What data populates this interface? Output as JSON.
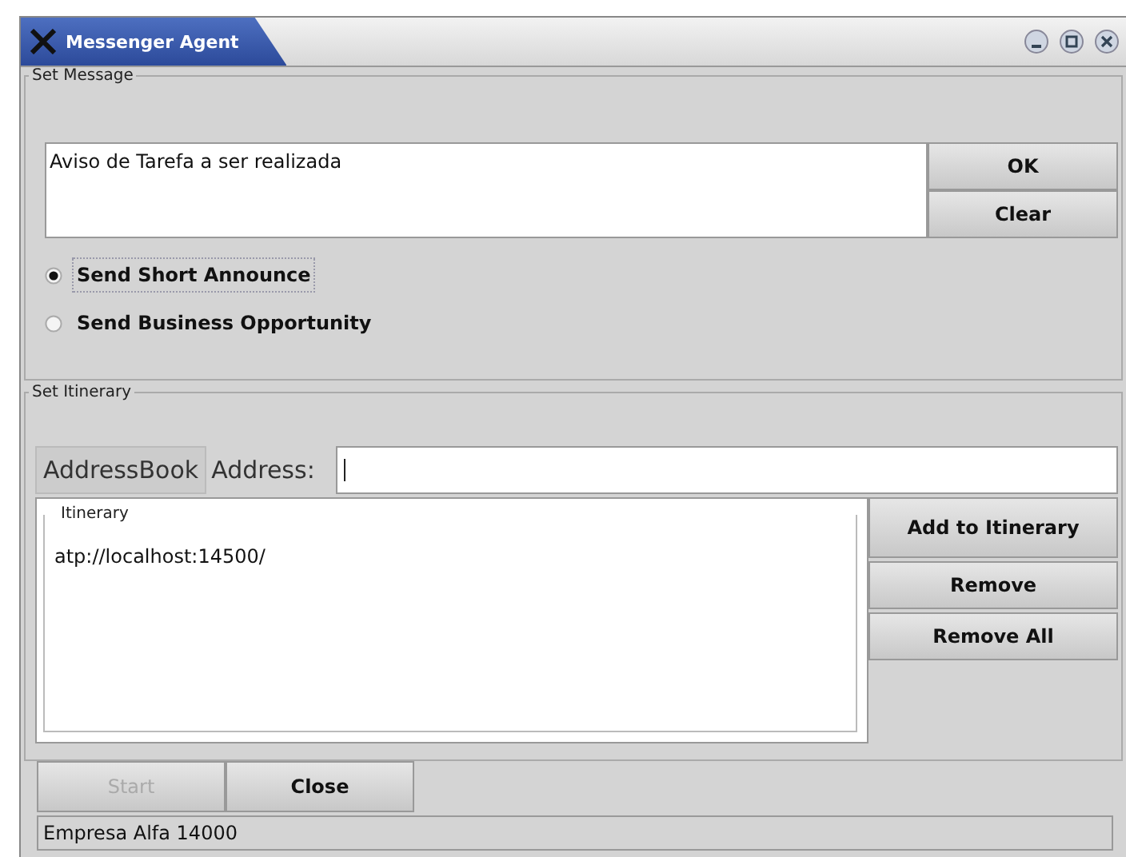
{
  "window": {
    "title": "Messenger Agent"
  },
  "set_message": {
    "title": "Set Message",
    "message": "Aviso de Tarefa a ser realizada",
    "buttons": [
      "OK",
      "Clear"
    ],
    "options": [
      {
        "label": "Send Short Announce",
        "selected": true
      },
      {
        "label": "Send Business Opportunity",
        "selected": false
      }
    ]
  },
  "set_itinerary": {
    "title": "Set Itinerary",
    "address_book_button": "AddressBook",
    "address_label": "Address:",
    "itinerary": {
      "title": "Itinerary",
      "items": [
        "atp://localhost:14500/"
      ]
    },
    "buttons": [
      "Add to Itinerary",
      "Remove",
      "Remove All"
    ]
  },
  "footer_buttons": [
    {
      "label": "Start",
      "disabled": true
    },
    {
      "label": "Close",
      "disabled": false
    }
  ],
  "status_bar": "Empresa Alfa 14000"
}
